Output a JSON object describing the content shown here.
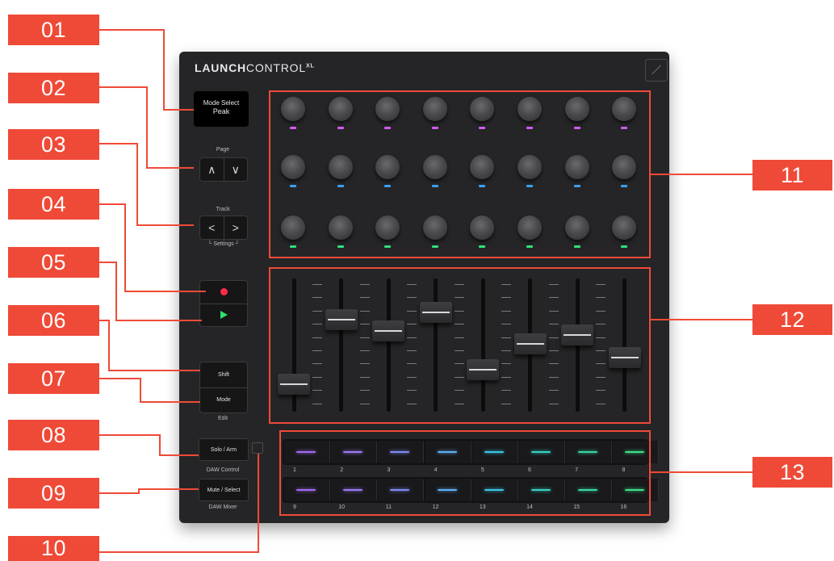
{
  "callouts": {
    "c01": "01",
    "c02": "02",
    "c03": "03",
    "c04": "04",
    "c05": "05",
    "c06": "06",
    "c07": "07",
    "c08": "08",
    "c09": "09",
    "c10": "10",
    "c11": "11",
    "c12": "12",
    "c13": "13"
  },
  "logo": {
    "bold": "LAUNCH",
    "light": "CONTROL",
    "sup": "XL"
  },
  "screen": {
    "label": "Mode Select",
    "value": "Peak"
  },
  "labels": {
    "page": "Page",
    "track": "Track",
    "settings": "└ Settings ┘",
    "edit": "Edit",
    "daw_control": "DAW Control",
    "daw_mixer": "DAW Mixer"
  },
  "buttons": {
    "page_up": "∧",
    "page_down": "∨",
    "track_left": "<",
    "track_right": ">",
    "shift": "Shift",
    "mode": "Mode",
    "solo_arm": "Solo / Arm",
    "mute_select": "Mute / Select"
  },
  "colors": {
    "accent": "#ef4a37",
    "knob_row_leds": [
      "#d05cf0",
      "#3aa0f0",
      "#2de07a"
    ],
    "pad_row1": [
      "#a36bf2",
      "#9b7af4",
      "#7f8cf6",
      "#5fb0f4",
      "#3cc6e8",
      "#36d2c4",
      "#38d9a6",
      "#3fe08a"
    ],
    "pad_row2": [
      "#a36bf2",
      "#9b7af4",
      "#7f8cf6",
      "#5fb0f4",
      "#3cc6e8",
      "#36d2c4",
      "#38d9a6",
      "#3fe08a"
    ]
  },
  "faders": {
    "levels": [
      0.12,
      0.78,
      0.66,
      0.85,
      0.27,
      0.53,
      0.62,
      0.39
    ]
  },
  "pad_numbers_row1": [
    "1",
    "2",
    "3",
    "4",
    "5",
    "6",
    "7",
    "8"
  ],
  "pad_numbers_row2": [
    "9",
    "10",
    "11",
    "12",
    "13",
    "14",
    "15",
    "16"
  ]
}
